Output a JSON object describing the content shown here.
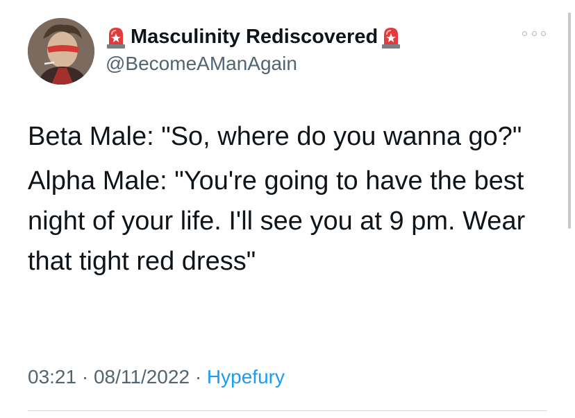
{
  "author": {
    "display_name": "Masculinity Rediscovered",
    "handle": "@BecomeAManAgain",
    "name_emoji_icon": "police-siren-icon"
  },
  "tweet": {
    "lines": [
      "Beta Male: \"So, where do you wanna go?\"",
      "Alpha Male: \"You're going to have the best night of your life. I'll see you at 9 pm. Wear that tight red dress\""
    ],
    "time": "03:21",
    "separator": "·",
    "date": "08/11/2022",
    "source": "Hypefury"
  },
  "colors": {
    "text": "#0f1419",
    "secondary": "#536471",
    "link": "#1d9bf0",
    "divider": "#cfd9de"
  }
}
